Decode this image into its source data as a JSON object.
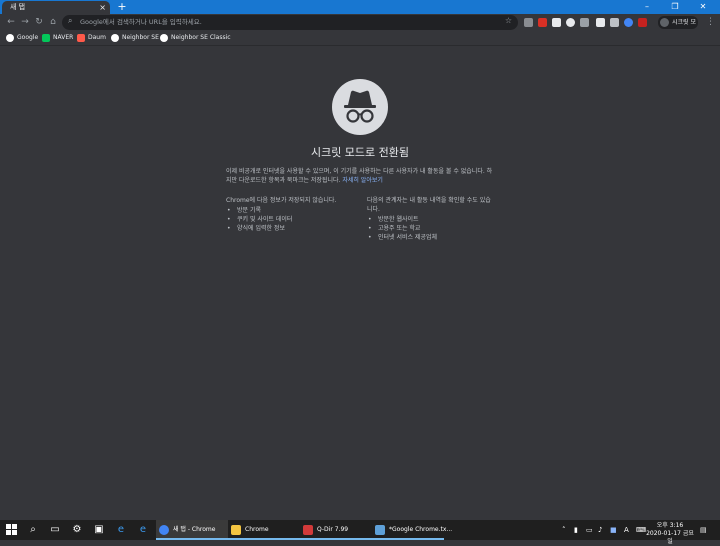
{
  "window": {
    "tab_title": "새 탭",
    "tab_close": "×",
    "new_tab": "+",
    "minimize": "–",
    "maximize": "❐",
    "close": "✕"
  },
  "toolbar": {
    "back": "←",
    "forward": "→",
    "reload": "↻",
    "home": "⌂",
    "omnibox_placeholder": "Google에서 검색하거나 URL을 입력하세요.",
    "star": "☆",
    "profile_label": "시크릿 모드",
    "menu": "⋮"
  },
  "bookmarks": [
    {
      "label": "Google",
      "color": "#ffffff"
    },
    {
      "label": "NAVER",
      "color": "#03c75a"
    },
    {
      "label": "Daum",
      "color": "#ff5a4a"
    },
    {
      "label": "Neighbor SE",
      "color": "#ffffff"
    },
    {
      "label": "Neighbor SE Classic",
      "color": "#ffffff"
    }
  ],
  "incognito": {
    "title": "시크릿 모드로 전환됨",
    "intro": "이제 비공개로 인터넷을 사용할 수 있으며, 이 기기를 사용하는 다른 사용자가 내 활동을 볼 수 없습니다. 하지만 다운로드한 항목과 북마크는 저장됩니다.",
    "learn_more": "자세히 알아보기",
    "left_heading": "Chrome에 다음 정보가 저장되지 않습니다.",
    "left_items": [
      "방문 기록",
      "쿠키 및 사이트 데이터",
      "양식에 입력한 정보"
    ],
    "right_heading": "다음의 관계자는 내 활동 내역을 확인할 수도 있습니다.",
    "right_items": [
      "방문한 웹사이트",
      "고용주 또는 학교",
      "인터넷 서비스 제공업체"
    ]
  },
  "taskbar": {
    "apps": [
      {
        "label": "새 탭 - Chrome",
        "color": "#4285f4"
      },
      {
        "label": "Chrome",
        "color": "#f4c542"
      },
      {
        "label": "Q-Dir 7.99",
        "color": "#d23a3a"
      },
      {
        "label": "*Google Chrome.tx...",
        "color": "#5ea0d8"
      }
    ],
    "clock_time": "오후 3:16",
    "clock_date": "2020-01-17 금요일",
    "tray_lang": "A"
  },
  "colors": {
    "titlebar": "#1877d1",
    "surface": "#35363a",
    "link": "#8ab4f8",
    "taskbar": "#1f1f1f"
  }
}
